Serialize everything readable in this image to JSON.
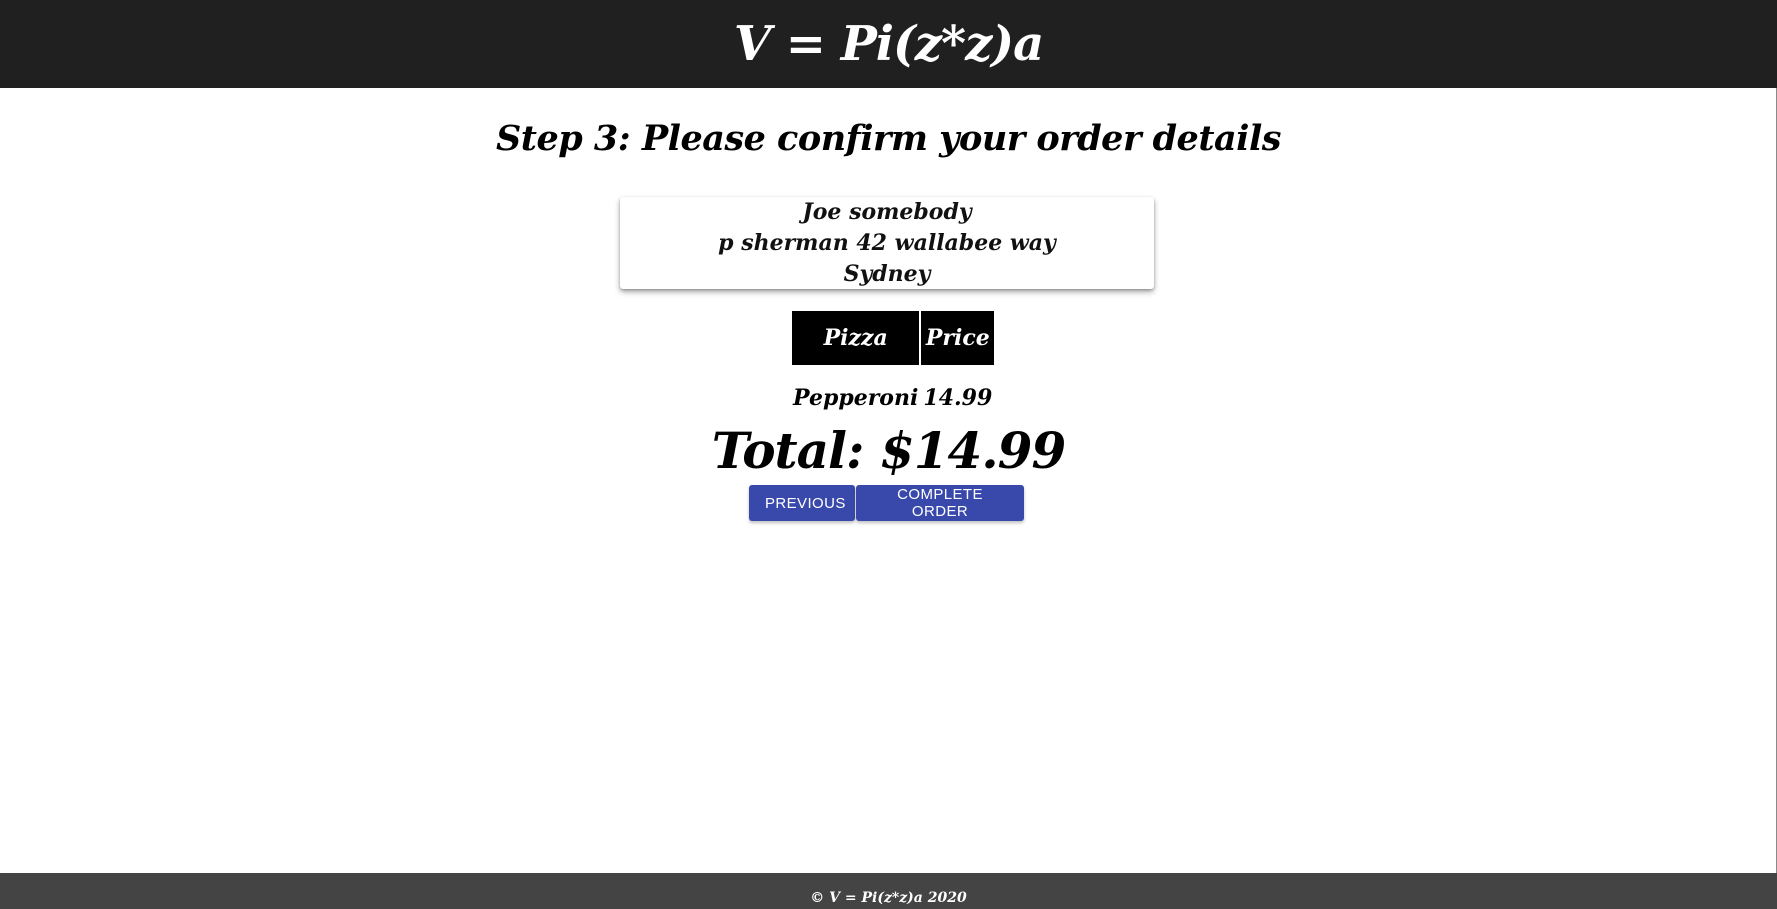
{
  "header": {
    "title": "V = Pi(z*z)a"
  },
  "main": {
    "step_title": "Step 3: Please confirm your order details",
    "address": {
      "name": "Joe somebody",
      "street": "p sherman 42 wallabee way",
      "city": "Sydney"
    },
    "order_table": {
      "headers": [
        "Pizza",
        "Price"
      ],
      "rows": [
        [
          "Pepperoni",
          "14.99"
        ]
      ]
    },
    "total": "Total: $14.99",
    "buttons": {
      "previous_label": "Previous",
      "complete_label": "Complete order"
    }
  },
  "footer": {
    "text": "© V = Pi(z*z)a 2020"
  },
  "colors": {
    "header_bg": "#202020",
    "footer_bg": "#444444",
    "button_bg": "#3949ab",
    "table_header_bg": "#000000"
  }
}
